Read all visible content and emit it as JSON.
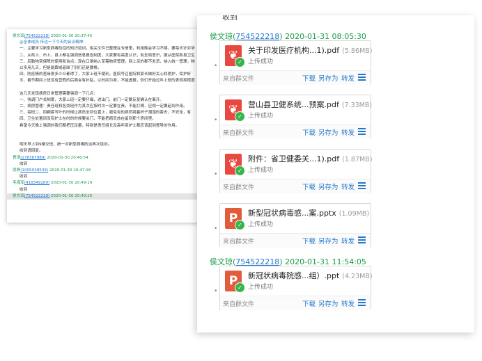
{
  "left_panel": {
    "lines": [
      {
        "type": "header",
        "sender": "侯文琼",
        "qq": "(754522218)",
        "time": "2020-01-30 20:37:45"
      },
      {
        "type": "body",
        "text": "@全体成员  传达一下今天的会议精神：",
        "blue": true
      },
      {
        "type": "body",
        "text": "一、主要学习新型病毒防控的知识培训，相关文件已整理在专册里，利用晚会学习不够，要每天针对学"
      },
      {
        "type": "body",
        "text": "二、从県上、市上、县上都在强调信息报告制度，大家要有高度认识，有全局意识，服从医院和县卫生"
      },
      {
        "type": "body",
        "text": "三、后勤物资保障的使用和询点，现在口罩纳入军需物资管理，网上买的都不发货，纳入统一管理，物"
      },
      {
        "type": "body",
        "text": "以多用几天，但是能跟或者缺了别们还是要换。"
      },
      {
        "type": "body",
        "text": "四、防疫情的差缘很多少众都得了，大家上班不便利，医院号召医院和家长做好关心和爱护，保护好"
      },
      {
        "type": "body",
        "text": "五、春节期间上班没有营假的后面会有补贴，以时间为准，不能虚报，你们开始过年上班的表现和程度"
      },
      {
        "type": "gap"
      },
      {
        "type": "body",
        "text": "这几天发现病房日常管理需要强调一下几点："
      },
      {
        "type": "body",
        "text": "一、強调门户关制度，大家上班一定要仔细，进出门、前门一定要反复确认在离开。"
      },
      {
        "type": "body",
        "text": "二、病房管理：责任班和各类班作为其次应按时次一定要在责，不能打搏，应视一定要起到作用。"
      },
      {
        "type": "body",
        "text": "三、每班二、四嗣套写叶的时候让病员全到位置上，避免有的病员跳着杯子潮湿的套去，不安全，有"
      },
      {
        "type": "body",
        "text": "四、卫生处置间没有护士在时的时候要关门，不能把病员放在留到那个房间里。"
      },
      {
        "type": "body",
        "text": "希望今天晚上强调的我们都把压足量，特别是责任组长及高年资护士都应该起到督导的作用。"
      },
      {
        "type": "gap"
      },
      {
        "type": "gap"
      },
      {
        "type": "body",
        "text": "明天早上到9楼交班，统一对新型病毒防治再次培训。"
      },
      {
        "type": "body",
        "text": "收到请回复。"
      },
      {
        "type": "header",
        "sender": "青琦",
        "qq": "(276387989)",
        "time": "2020-01-30 20:40:54"
      },
      {
        "type": "body",
        "text": "收到"
      },
      {
        "type": "header",
        "sender": "贾婷",
        "qq": "(1005038539)",
        "time": "2020-01-30 20:47:18"
      },
      {
        "type": "body",
        "text": "收到"
      },
      {
        "type": "header",
        "sender": "毛海军",
        "qq": "(418349289)",
        "time": "2020-01-30 20:49:19"
      },
      {
        "type": "body",
        "text": "收到"
      },
      {
        "type": "header",
        "sender": "侯文琼",
        "qq": "(754522218)",
        "time": "2020-01-30 20:49:26",
        "selected": true
      }
    ]
  },
  "right_panel": {
    "cut_text": "收到",
    "messages": [
      {
        "sender": "侯文琼",
        "qq": "754522218",
        "time": "2020-01-31 08:05:30"
      },
      {
        "sender": "侯文琼",
        "qq": "754522218",
        "time": "2020-01-31 11:54:05"
      }
    ],
    "files": [
      {
        "icon": "pdf-icon",
        "name": "关于印发医疗机构...1).pdf",
        "size": "(5.86MB)",
        "status": "上传成功",
        "from": "来自群文件"
      },
      {
        "icon": "pdf-icon",
        "name": "营山县卫健系统...预案.pdf",
        "size": "(7.33MB)",
        "status": "上传成功",
        "from": "来自群文件"
      },
      {
        "icon": "pdf-icon",
        "name": "附件：省卫健委关...1).pdf",
        "size": "(1.87MB)",
        "status": "上传成功",
        "from": "来自群文件"
      },
      {
        "icon": "ppt-icon",
        "name": "新型冠状病毒感...案.pptx",
        "size": "(1.09MB)",
        "status": "上传成功",
        "from": "来自群文件"
      },
      {
        "icon": "ppt-icon",
        "name": "新冠状病毒院感...组）.ppt",
        "size": "(4.23MB)",
        "status": "上传成功",
        "from": "来自群文件"
      }
    ],
    "actions": {
      "download": "下载",
      "save_as": "另存为",
      "forward": "转发"
    }
  }
}
